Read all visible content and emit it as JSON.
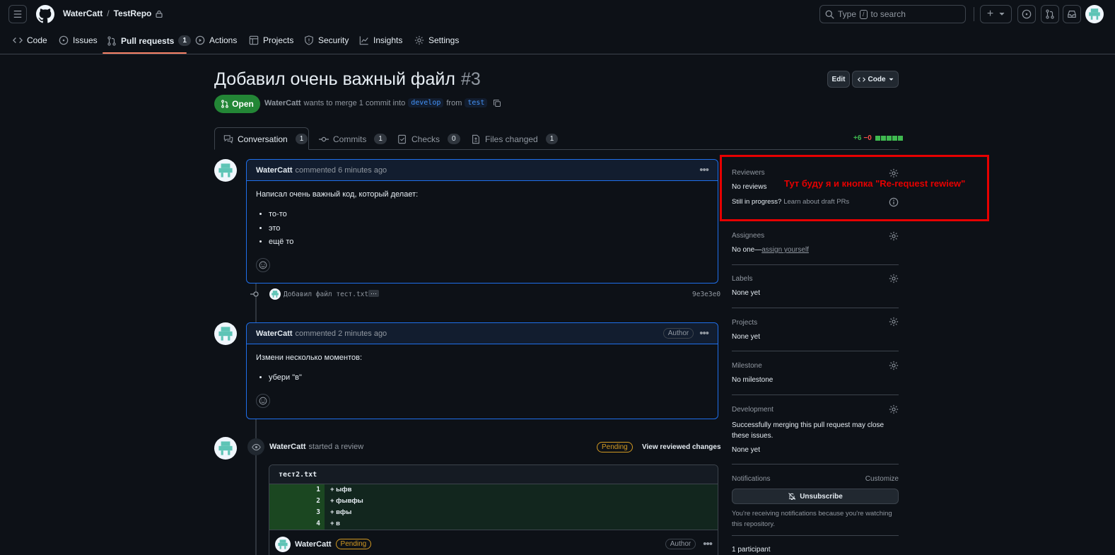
{
  "header": {
    "owner": "WaterCatt",
    "repo": "TestRepo",
    "search_prefix": "Type",
    "search_key": "/",
    "search_suffix": "to search",
    "plus": "+"
  },
  "nav": {
    "code": "Code",
    "issues": "Issues",
    "pulls": "Pull requests",
    "pulls_count": "1",
    "actions": "Actions",
    "projects": "Projects",
    "security": "Security",
    "insights": "Insights",
    "settings": "Settings"
  },
  "pr": {
    "title": "Добавил очень важный файл",
    "number": "#3",
    "status": "Open",
    "author": "WaterCatt",
    "merge_text": "wants to merge 1 commit into",
    "base": "develop",
    "from": "from",
    "head": "test",
    "edit": "Edit",
    "code": "Code"
  },
  "tabs": {
    "conversation": "Conversation",
    "conversation_count": "1",
    "commits": "Commits",
    "commits_count": "1",
    "checks": "Checks",
    "checks_count": "0",
    "files": "Files changed",
    "files_count": "1",
    "additions": "+6",
    "deletions": "−0"
  },
  "comment1": {
    "author": "WaterCatt",
    "time": "commented 6 minutes ago",
    "body": "Написал очень важный код, который делает:",
    "items": [
      "то-то",
      "это",
      "ещё то"
    ]
  },
  "commit": {
    "message": "Добавил файл тест.txt",
    "ellipsis": "···",
    "sha": "9e3e3e0"
  },
  "comment2": {
    "author": "WaterCatt",
    "time": "commented 2 minutes ago",
    "badge": "Author",
    "body": "Измени несколько моментов:",
    "items": [
      "убери \"в\""
    ]
  },
  "review": {
    "author": "WaterCatt",
    "action": "started a review",
    "status": "Pending",
    "view": "View reviewed changes",
    "file": "тест2.txt",
    "lines": [
      {
        "num": "1",
        "text": "+ ыфв"
      },
      {
        "num": "2",
        "text": "+ фывфы"
      },
      {
        "num": "3",
        "text": "+ вфы"
      },
      {
        "num": "4",
        "text": "+ в"
      }
    ],
    "reply_author": "WaterCatt",
    "reply_status": "Pending",
    "reply_badge": "Author"
  },
  "sidebar": {
    "reviewers_title": "Reviewers",
    "reviewers_value": "No reviews",
    "draft_text": "Still in progress?",
    "draft_link": "Learn about draft PRs",
    "assignees_title": "Assignees",
    "assignees_value": "No one—",
    "assignees_link": "assign yourself",
    "labels_title": "Labels",
    "labels_value": "None yet",
    "projects_title": "Projects",
    "projects_value": "None yet",
    "milestone_title": "Milestone",
    "milestone_value": "No milestone",
    "development_title": "Development",
    "development_text": "Successfully merging this pull request may close these issues.",
    "development_value": "None yet",
    "notifications_title": "Notifications",
    "customize": "Customize",
    "unsubscribe": "Unsubscribe",
    "notif_text": "You're receiving notifications because you're watching this repository.",
    "participants": "1 participant"
  },
  "annotation": {
    "text": "Тут буду я и кнопка \"Re-request rewiew\"",
    "color": "#e60000"
  },
  "colors": {
    "bg": "#0d1117",
    "open_green": "#238636",
    "accent_blue": "#1f6feb",
    "nav_underline": "#f78166"
  }
}
